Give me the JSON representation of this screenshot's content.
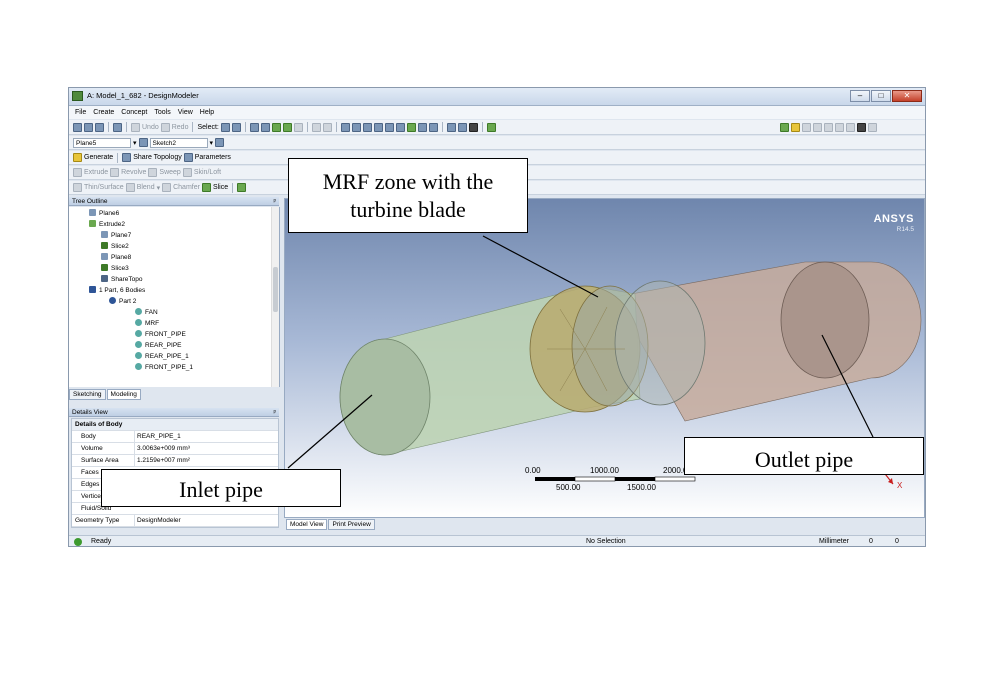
{
  "window": {
    "title": "A: Model_1_682 - DesignModeler"
  },
  "menu": [
    "File",
    "Create",
    "Concept",
    "Tools",
    "View",
    "Help"
  ],
  "toolbar1": {
    "undo": "Undo",
    "redo": "Redo",
    "select": "Select:"
  },
  "toolbar2": {
    "plane": "Plane5",
    "sketch": "Sketch2"
  },
  "toolbar3": {
    "generate": "Generate",
    "share_topology": "Share Topology",
    "parameters": "Parameters"
  },
  "toolbar4": [
    "Extrude",
    "Revolve",
    "Sweep",
    "Skin/Loft"
  ],
  "toolbar5": [
    "Thin/Surface",
    "Blend",
    "Chamfer",
    "Slice"
  ],
  "tree": {
    "header": "Tree Outline",
    "items": [
      {
        "label": "Plane6",
        "indent": 1
      },
      {
        "label": "Extrude2",
        "indent": 1
      },
      {
        "label": "Plane7",
        "indent": 1
      },
      {
        "label": "Slice2",
        "indent": 1
      },
      {
        "label": "Plane8",
        "indent": 1
      },
      {
        "label": "Slice3",
        "indent": 1
      },
      {
        "label": "ShareTopo",
        "indent": 1
      },
      {
        "label": "1 Part, 6 Bodies",
        "indent": 1
      },
      {
        "label": "Part 2",
        "indent": 2
      },
      {
        "label": "FAN",
        "indent": 3
      },
      {
        "label": "MRF",
        "indent": 3
      },
      {
        "label": "FRONT_PIPE",
        "indent": 3
      },
      {
        "label": "REAR_PIPE",
        "indent": 3
      },
      {
        "label": "REAR_PIPE_1",
        "indent": 3
      },
      {
        "label": "FRONT_PIPE_1",
        "indent": 3
      }
    ]
  },
  "panel_tabs": [
    "Sketching",
    "Modeling"
  ],
  "details": {
    "header": "Details View",
    "section": "Details of Body",
    "rows": [
      {
        "key": "Body",
        "value": "REAR_PIPE_1"
      },
      {
        "key": "Volume",
        "value": "3.0063e+009 mm³"
      },
      {
        "key": "Surface Area",
        "value": "1.2159e+007 mm²"
      },
      {
        "key": "Faces",
        "value": ""
      },
      {
        "key": "Edges",
        "value": ""
      },
      {
        "key": "Vertices",
        "value": ""
      },
      {
        "key": "Fluid/Solid",
        "value": ""
      },
      {
        "key": "Geometry Type",
        "value": "DesignModeler"
      }
    ]
  },
  "viewport": {
    "brand": "ANSYS",
    "version": "R14.5",
    "scale_top": [
      "0.00",
      "1000.00",
      "2000.00 (mm)"
    ],
    "scale_bottom": [
      "500.00",
      "1500.00"
    ],
    "axis": "X"
  },
  "view_tabs": [
    "Model View",
    "Print Preview"
  ],
  "status": {
    "ready": "Ready",
    "selection": "No Selection",
    "units": "Millimeter",
    "v1": "0",
    "v2": "0"
  },
  "annotations": {
    "mrf_line1": "MRF zone with the",
    "mrf_line2": "turbine blade",
    "inlet": "Inlet pipe",
    "outlet": "Outlet pipe"
  },
  "colors": {
    "inlet_pipe": "#bcd3b4",
    "mrf_zone": "#b8aa6e",
    "outlet_pipe": "#c7ab9c",
    "axis": "#c81e1e"
  }
}
